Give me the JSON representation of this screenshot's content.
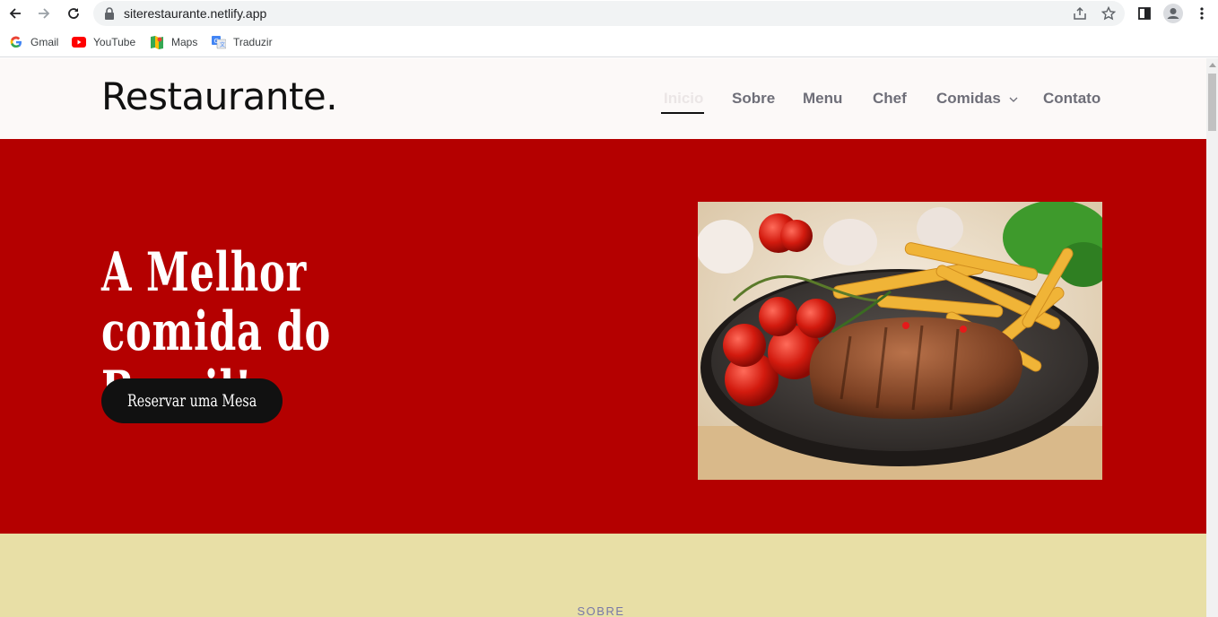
{
  "browser": {
    "url": "siterestaurante.netlify.app",
    "bookmarks": [
      {
        "label": "Gmail",
        "icon": "google-icon"
      },
      {
        "label": "YouTube",
        "icon": "youtube-icon"
      },
      {
        "label": "Maps",
        "icon": "maps-icon"
      },
      {
        "label": "Traduzir",
        "icon": "translate-icon"
      }
    ]
  },
  "site": {
    "logo": "Restaurante.",
    "nav": [
      "Inicio",
      "Sobre",
      "Menu",
      "Chef",
      "Comidas",
      "Contato"
    ],
    "active_nav": "Inicio"
  },
  "hero": {
    "title": "A Melhor comida do Brasil!",
    "button": "Reservar uma Mesa",
    "background": "#b40000"
  },
  "about": {
    "label": "SOBRE",
    "background": "#e8dfa6"
  }
}
